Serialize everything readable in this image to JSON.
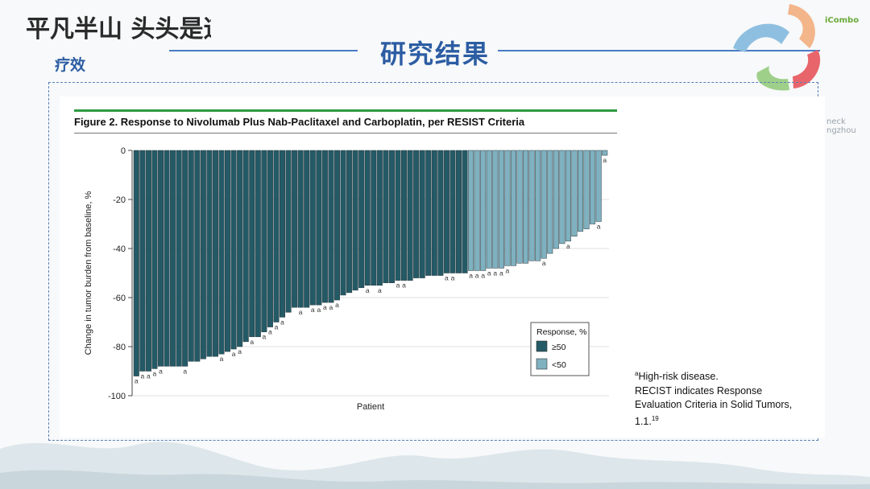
{
  "header": {
    "slogan": "平凡半山 头头是道",
    "section_label": "疗效",
    "page_title": "研究结果",
    "brand_logo": "iCombo",
    "side_text": [
      "neck",
      "ngzhou"
    ]
  },
  "figure": {
    "title": "Figure 2. Response to Nivolumab Plus Nab-Paclitaxel and Carboplatin, per RESIST Criteria",
    "footnote_a_sup": "a",
    "footnote_a_text": "High-risk disease.",
    "footnote_recist": "RECIST indicates Response Evaluation Criteria in Solid Tumors, 1.1.",
    "footnote_ref": "19"
  },
  "chart_data": {
    "type": "bar",
    "title": "",
    "xlabel": "Patient",
    "ylabel": "Change in tumor burden from baseline, %",
    "ylim": [
      -100,
      0
    ],
    "yticks": [
      0,
      -20,
      -40,
      -60,
      -80,
      -100
    ],
    "grid": true,
    "legend": {
      "title": "Response, %",
      "placement": "bottom-right",
      "entries": [
        {
          "label": "≥50",
          "color": "#245a66"
        },
        {
          "label": "<50",
          "color": "#7fb1c0"
        }
      ]
    },
    "annotation_label": "a",
    "series": [
      {
        "name": "≥50",
        "color": "#245a66",
        "values": [
          -92,
          -90,
          -90,
          -89,
          -88,
          -88,
          -88,
          -88,
          -88,
          -86,
          -86,
          -85,
          -84,
          -84,
          -83,
          -82,
          -81,
          -80,
          -78,
          -76,
          -76,
          -74,
          -72,
          -70,
          -68,
          -66,
          -64,
          -64,
          -64,
          -63,
          -63,
          -62,
          -62,
          -61,
          -59,
          -58,
          -57,
          -56,
          -55,
          -55,
          -55,
          -54,
          -54,
          -53,
          -53,
          -53,
          -52,
          -52,
          -51,
          -51,
          -51,
          -50,
          -50,
          -50,
          -50
        ],
        "annotated": [
          true,
          true,
          true,
          true,
          true,
          false,
          false,
          false,
          true,
          false,
          false,
          false,
          false,
          false,
          true,
          false,
          true,
          true,
          false,
          true,
          false,
          true,
          true,
          true,
          true,
          false,
          false,
          true,
          false,
          true,
          true,
          true,
          true,
          true,
          false,
          false,
          false,
          false,
          true,
          false,
          true,
          false,
          false,
          true,
          true,
          false,
          false,
          false,
          false,
          false,
          false,
          true,
          true,
          false,
          false
        ]
      },
      {
        "name": "<50",
        "color": "#7fb1c0",
        "values": [
          -49,
          -49,
          -49,
          -48,
          -48,
          -48,
          -47,
          -47,
          -46,
          -46,
          -45,
          -45,
          -44,
          -42,
          -40,
          -38,
          -37,
          -35,
          -33,
          -32,
          -30,
          -29,
          -2
        ],
        "annotated": [
          true,
          true,
          true,
          true,
          true,
          true,
          true,
          false,
          false,
          false,
          false,
          false,
          true,
          false,
          false,
          false,
          true,
          false,
          false,
          false,
          false,
          true,
          true
        ]
      }
    ]
  }
}
